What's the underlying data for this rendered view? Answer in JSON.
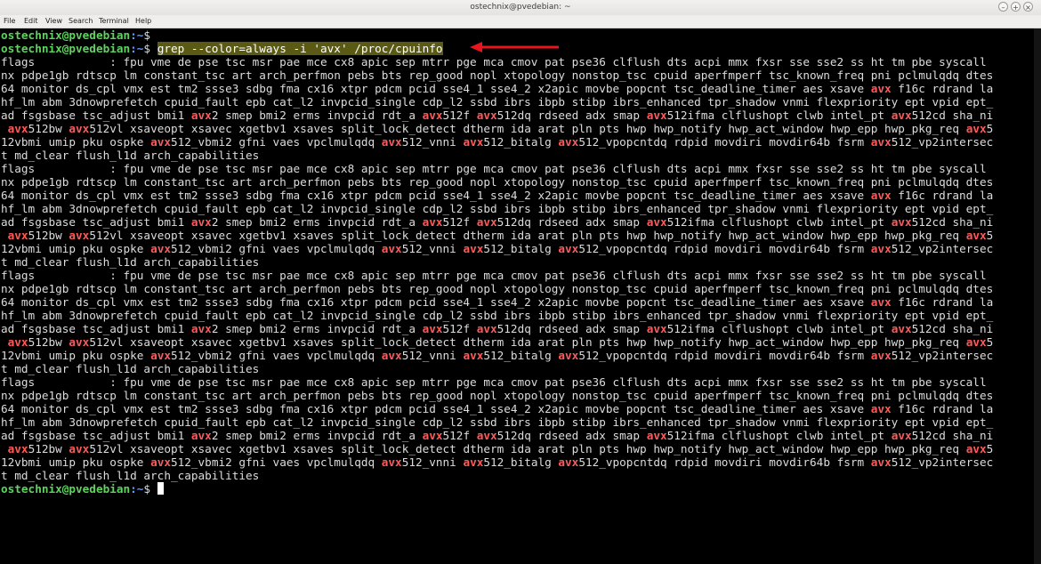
{
  "window": {
    "title": "ostechnix@pvedebian: ~",
    "controls": [
      "–",
      "+",
      "×"
    ]
  },
  "menu": [
    "File",
    "Edit",
    "View",
    "Search",
    "Terminal",
    "Help"
  ],
  "prompt": {
    "user_host": "ostechnix@pvedebian",
    "path": ":~",
    "symbol": "$ "
  },
  "command": "grep --color=always -i 'avx' /proc/cpuinfo",
  "flag_block": [
    [
      [
        "flags           : fpu vme de pse tsc msr pae mce cx8 apic sep mtrr pge mca cmov pat pse36 clflush dts acpi mmx fxsr sse sse2 ss ht tm pbe syscall",
        0
      ]
    ],
    [
      [
        "nx pdpe1gb rdtscp lm constant_tsc art arch_perfmon pebs bts rep_good nopl xtopology nonstop_tsc cpuid aperfmperf tsc_known_freq pni pclmulqdq dtes",
        0
      ]
    ],
    [
      [
        "64 monitor ds_cpl vmx est tm2 ssse3 sdbg fma cx16 xtpr pdcm pcid sse4_1 sse4_2 x2apic movbe popcnt tsc_deadline_timer aes xsave ",
        0
      ],
      [
        "avx",
        1
      ],
      [
        " f16c rdrand la",
        0
      ]
    ],
    [
      [
        "hf_lm abm 3dnowprefetch cpuid_fault epb cat_l2 invpcid_single cdp_l2 ssbd ibrs ibpb stibp ibrs_enhanced tpr_shadow vnmi flexpriority ept vpid ept_",
        0
      ]
    ],
    [
      [
        "ad fsgsbase tsc_adjust bmi1 ",
        0
      ],
      [
        "avx",
        1
      ],
      [
        "2 smep bmi2 erms invpcid rdt_a ",
        0
      ],
      [
        "avx",
        1
      ],
      [
        "512f ",
        0
      ],
      [
        "avx",
        1
      ],
      [
        "512dq rdseed adx smap ",
        0
      ],
      [
        "avx",
        1
      ],
      [
        "512ifma clflushopt clwb intel_pt ",
        0
      ],
      [
        "avx",
        1
      ],
      [
        "512cd sha_ni",
        0
      ]
    ],
    [
      [
        " ",
        0
      ],
      [
        "avx",
        1
      ],
      [
        "512bw ",
        0
      ],
      [
        "avx",
        1
      ],
      [
        "512vl xsaveopt xsavec xgetbv1 xsaves split_lock_detect dtherm ida arat pln pts hwp hwp_notify hwp_act_window hwp_epp hwp_pkg_req ",
        0
      ],
      [
        "avx",
        1
      ],
      [
        "5",
        0
      ]
    ],
    [
      [
        "12vbmi umip pku ospke ",
        0
      ],
      [
        "avx",
        1
      ],
      [
        "512_vbmi2 gfni vaes vpclmulqdq ",
        0
      ],
      [
        "avx",
        1
      ],
      [
        "512_vnni ",
        0
      ],
      [
        "avx",
        1
      ],
      [
        "512_bitalg ",
        0
      ],
      [
        "avx",
        1
      ],
      [
        "512_vpopcntdq rdpid movdiri movdir64b fsrm ",
        0
      ],
      [
        "avx",
        1
      ],
      [
        "512_vp2intersec",
        0
      ]
    ],
    [
      [
        "t md_clear flush_l1d arch_capabilities",
        0
      ]
    ]
  ],
  "repeat_count": 4
}
